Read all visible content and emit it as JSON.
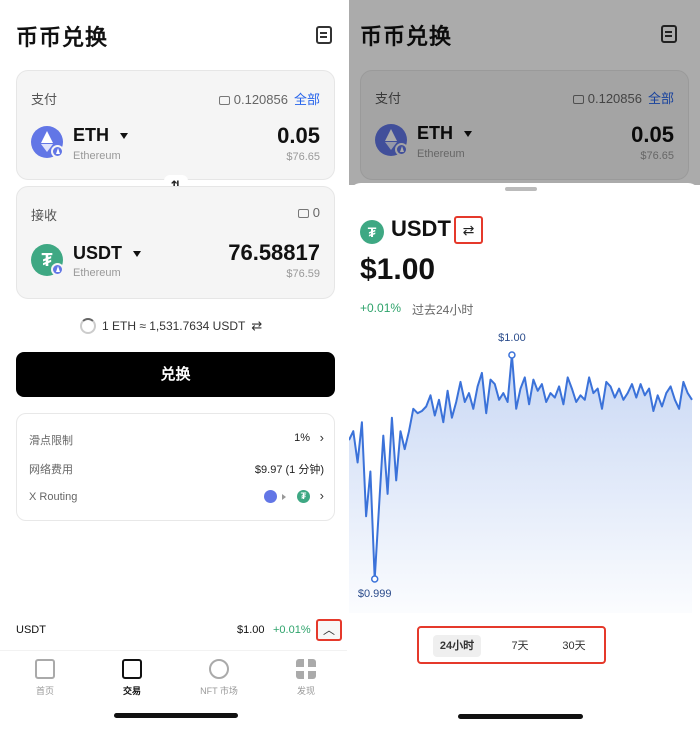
{
  "left": {
    "title": "币币兑换",
    "pay": {
      "label": "支付",
      "balance": "0.120856",
      "all_label": "全部",
      "symbol": "ETH",
      "network": "Ethereum",
      "amount": "0.05",
      "fiat": "$76.65"
    },
    "receive": {
      "label": "接收",
      "balance": "0",
      "symbol": "USDT",
      "network": "Ethereum",
      "amount": "76.58817",
      "fiat": "$76.59"
    },
    "rate": "1 ETH ≈ 1,531.7634 USDT",
    "swap_button": "兑换",
    "details": [
      {
        "label": "滑点限制",
        "value": "1%"
      },
      {
        "label": "网络费用",
        "value": "$9.97 (1 分钟)"
      },
      {
        "label": "X Routing",
        "value": ""
      }
    ],
    "ticker": {
      "symbol": "USDT",
      "price": "$1.00",
      "change": "+0.01%"
    },
    "tabs": [
      {
        "label": "首页",
        "icon": "home-icon"
      },
      {
        "label": "交易",
        "icon": "trade-icon"
      },
      {
        "label": "NFT 市场",
        "icon": "nft-icon"
      },
      {
        "label": "发现",
        "icon": "discover-icon"
      }
    ]
  },
  "right": {
    "title": "币币兑换",
    "pay": {
      "label": "支付",
      "balance": "0.120856",
      "all_label": "全部",
      "symbol": "ETH",
      "network": "Ethereum",
      "amount": "0.05",
      "fiat": "$76.65"
    },
    "sheet": {
      "symbol": "USDT",
      "price": "$1.00",
      "change": "+0.01%",
      "period_label": "过去24小时",
      "periods": [
        "24小时",
        "7天",
        "30天"
      ],
      "active_period": "24小时"
    }
  },
  "colors": {
    "accent_blue": "#2563eb",
    "positive_green": "#2ea36b",
    "highlight_red": "#e5392b",
    "line_blue": "#3b72d9"
  },
  "chart_data": {
    "type": "area",
    "title": "",
    "xlabel": "",
    "ylabel": "",
    "annotations": [
      {
        "label": "$1.00",
        "kind": "max"
      },
      {
        "label": "$0.999",
        "kind": "min"
      }
    ],
    "ylim": [
      0.999,
      1.0
    ],
    "y": [
      0.99962,
      0.99966,
      0.99952,
      0.9997,
      0.99928,
      0.99948,
      0.999,
      0.99932,
      0.99964,
      0.99938,
      0.99972,
      0.99944,
      0.99966,
      0.99958,
      0.99966,
      0.99976,
      0.99974,
      0.99975,
      0.99977,
      0.99982,
      0.99973,
      0.9998,
      0.9997,
      0.99984,
      0.99972,
      0.99979,
      0.99988,
      0.99979,
      0.99983,
      0.99976,
      0.99986,
      0.99992,
      0.99974,
      0.99989,
      0.99987,
      0.9998,
      0.99983,
      0.99979,
      1.0,
      0.99976,
      0.99985,
      0.9999,
      0.99978,
      0.99989,
      0.99984,
      0.99987,
      0.99979,
      0.99983,
      0.99981,
      0.99986,
      0.99978,
      0.9999,
      0.99985,
      0.99979,
      0.99982,
      0.9998,
      0.9999,
      0.99983,
      0.99985,
      0.99976,
      0.99988,
      0.99986,
      0.99981,
      0.99985,
      0.9998,
      0.99983,
      0.99987,
      0.99981,
      0.99987,
      0.99982,
      0.99985,
      0.99975,
      0.99982,
      0.99977,
      0.99983,
      0.99986,
      0.9998,
      0.99976,
      0.99988,
      0.99983,
      0.9998
    ]
  }
}
